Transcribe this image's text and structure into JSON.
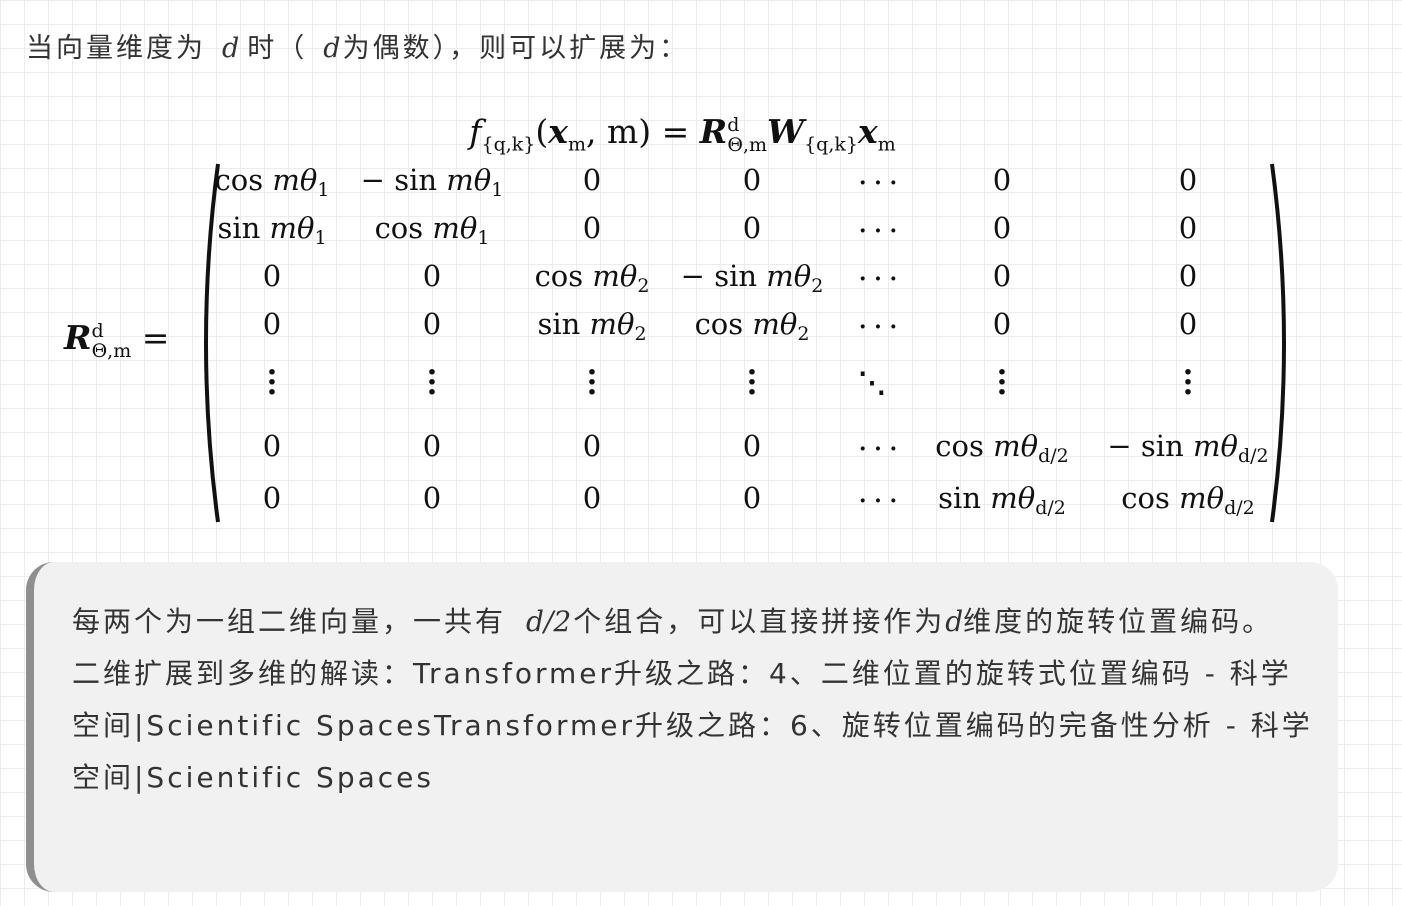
{
  "intro": {
    "prefix": "当向量维度为",
    "var1": "d",
    "mid": "时（",
    "var2": "d",
    "suffix": "为偶数），则可以扩展为："
  },
  "equation": {
    "f_sub": "{q,k}",
    "args_open": "(",
    "x_sub": "m",
    "args_rest": ", m) = ",
    "R_sup": "d",
    "R_sub": "Θ,m",
    "W_sub": "{q,k}",
    "x2_sub": "m"
  },
  "matrix": {
    "lhs_sup": "d",
    "lhs_sub": "Θ,m",
    "lhs_eq": "=",
    "rows": [
      [
        "cos mθ|1",
        "− sin mθ|1",
        "0",
        "0",
        "⋯",
        "0",
        "0"
      ],
      [
        "sin mθ|1",
        "cos mθ|1",
        "0",
        "0",
        "⋯",
        "0",
        "0"
      ],
      [
        "0",
        "0",
        "cos mθ|2",
        "− sin mθ|2",
        "⋯",
        "0",
        "0"
      ],
      [
        "0",
        "0",
        "sin mθ|2",
        "cos mθ|2",
        "⋯",
        "0",
        "0"
      ],
      [
        "⋮",
        "⋮",
        "⋮",
        "⋮",
        "⋱",
        "⋮",
        "⋮"
      ],
      [
        "0",
        "0",
        "0",
        "0",
        "⋯",
        "cos mθ|d/2",
        "− sin mθ|d/2"
      ],
      [
        "0",
        "0",
        "0",
        "0",
        "⋯",
        "sin mθ|d/2",
        "cos mθ|d/2"
      ]
    ]
  },
  "note": {
    "line1_a": "每两个为一组二维向量，一共有",
    "line1_var": "d/2",
    "line1_b": "个组合，可以直接拼接作为",
    "line1_var2": "d",
    "line1_c": "维度的旋转位置编码。",
    "line2": "二维扩展到多维的解读：Transformer升级之路：4、二维位置的旋转式位置编码 - 科学空间|Scientific SpacesTransformer升级之路：6、旋转位置编码的完备性分析 - 科学空间|Scientific Spaces"
  }
}
